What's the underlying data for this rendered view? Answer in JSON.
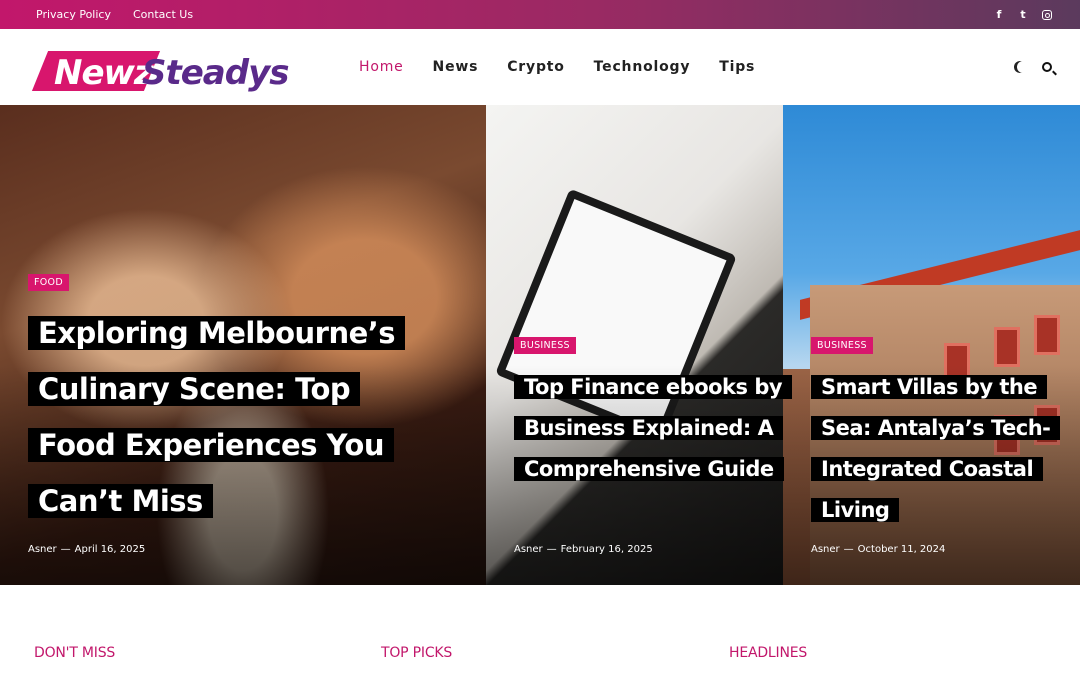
{
  "topbar": {
    "links": [
      "Privacy Policy",
      "Contact Us"
    ],
    "social_icons": [
      "facebook-icon",
      "twitter-icon",
      "instagram-icon"
    ]
  },
  "header": {
    "logo_part1": "Newz",
    "logo_part2": "Steadys",
    "nav": [
      "Home",
      "News",
      "Crypto",
      "Technology",
      "Tips"
    ],
    "active_nav": "Home",
    "icons": [
      "moon-icon",
      "search-icon"
    ]
  },
  "hero": [
    {
      "category": "FOOD",
      "title": "Exploring Melbourne’s Culinary Scene: Top Food Experiences You Can’t Miss",
      "author": "Asner",
      "date": "April 16, 2025"
    },
    {
      "category": "BUSINESS",
      "title": "Top Finance ebooks by Business Explained: A Comprehensive Guide",
      "author": "Asner",
      "date": "February 16, 2025"
    },
    {
      "category": "BUSINESS",
      "title": "Smart Villas by the Sea: Antalya’s Tech-Integrated Coastal Living",
      "author": "Asner",
      "date": "October 11, 2024"
    }
  ],
  "sections": [
    "DON'T MISS",
    "TOP PICKS",
    "HEADLINES"
  ],
  "colors": {
    "accent": "#d8166d",
    "topbar_start": "#c2176b",
    "topbar_end": "#5b3a5d",
    "logo_purple": "#5a2a8a"
  }
}
